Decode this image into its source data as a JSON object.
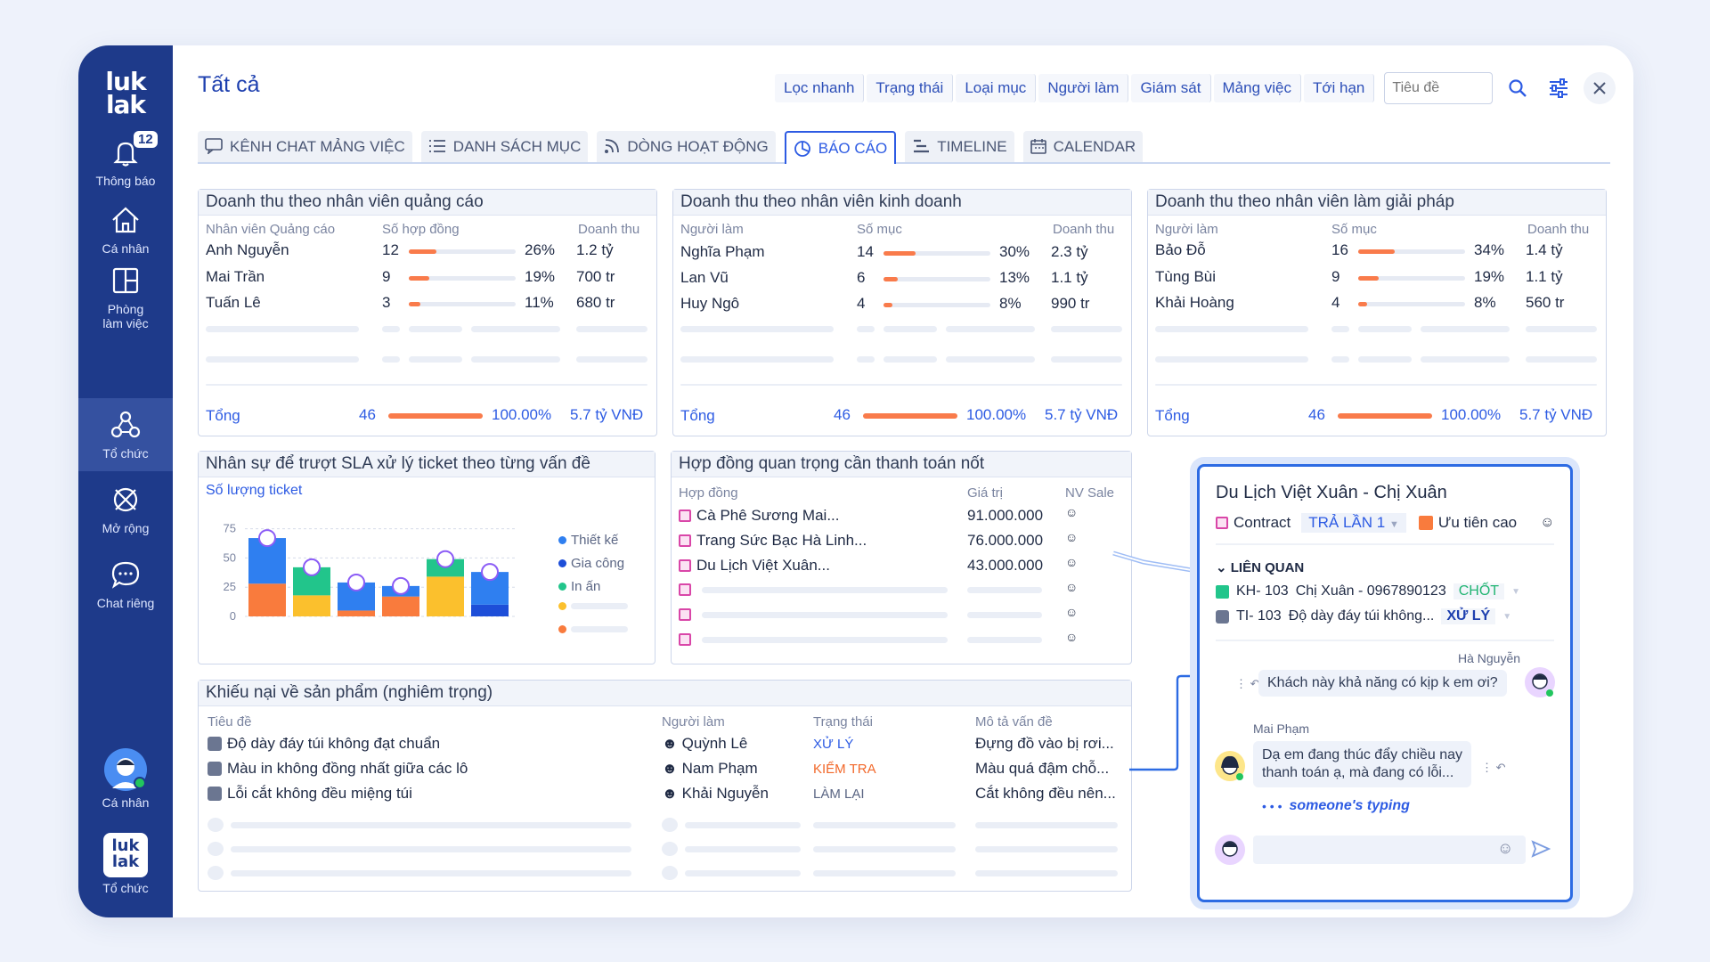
{
  "sidebar": {
    "logo": "luk lak",
    "notif_count": "12",
    "items": [
      {
        "label": "Thông báo"
      },
      {
        "label": "Cá nhân"
      },
      {
        "label": "Phòng làm việc"
      },
      {
        "label": "Tổ chức"
      },
      {
        "label": "Mở rộng"
      },
      {
        "label": "Chat riêng"
      }
    ],
    "profile_label": "Cá nhân",
    "org_label": "Tổ chức",
    "org_logo": "luk lak"
  },
  "header": {
    "title": "Tất cả",
    "filters": [
      "Lọc nhanh",
      "Trạng thái",
      "Loại mục",
      "Người làm",
      "Giám sát",
      "Mảng việc",
      "Tới hạn"
    ],
    "search_placeholder": "Tiêu đề"
  },
  "tabs": [
    "KÊNH CHAT MẢNG VIỆC",
    "DANH SÁCH MỤC",
    "DÒNG HOẠT ĐỘNG",
    "BÁO CÁO",
    "TIMELINE",
    "CALENDAR"
  ],
  "revenue_cards": [
    {
      "title": "Doanh thu theo nhân viên quảng cáo",
      "headers": [
        "Nhân viên Quảng cáo",
        "Số hợp đồng",
        "Doanh thu"
      ],
      "rows": [
        {
          "name": "Anh Nguyễn",
          "count": "12",
          "pct": "26%",
          "pct_value": 26,
          "revenue": "1.2 tỷ"
        },
        {
          "name": "Mai Trần",
          "count": "9",
          "pct": "19%",
          "pct_value": 19,
          "revenue": "700 tr"
        },
        {
          "name": "Tuấn Lê",
          "count": "3",
          "pct": "11%",
          "pct_value": 11,
          "revenue": "680 tr"
        }
      ],
      "total_label": "Tổng",
      "total_count": "46",
      "total_pct": "100.00%",
      "total_revenue": "5.7 tỷ VNĐ"
    },
    {
      "title": "Doanh thu theo nhân viên kinh doanh",
      "headers": [
        "Người làm",
        "Số mục",
        "Doanh thu"
      ],
      "rows": [
        {
          "name": "Nghĩa Phạm",
          "count": "14",
          "pct": "30%",
          "pct_value": 30,
          "revenue": "2.3 tỷ"
        },
        {
          "name": "Lan Vũ",
          "count": "6",
          "pct": "13%",
          "pct_value": 13,
          "revenue": "1.1 tỷ"
        },
        {
          "name": "Huy Ngô",
          "count": "4",
          "pct": "8%",
          "pct_value": 8,
          "revenue": "990 tr"
        }
      ],
      "total_label": "Tổng",
      "total_count": "46",
      "total_pct": "100.00%",
      "total_revenue": "5.7 tỷ VNĐ"
    },
    {
      "title": "Doanh thu theo nhân viên làm giải pháp",
      "headers": [
        "Người làm",
        "Số mục",
        "Doanh thu"
      ],
      "rows": [
        {
          "name": "Bảo Đỗ",
          "count": "16",
          "pct": "34%",
          "pct_value": 34,
          "revenue": "1.4 tỷ"
        },
        {
          "name": "Tùng Bùi",
          "count": "9",
          "pct": "19%",
          "pct_value": 19,
          "revenue": "1.1 tỷ"
        },
        {
          "name": "Khải Hoàng",
          "count": "4",
          "pct": "8%",
          "pct_value": 8,
          "revenue": "560 tr"
        }
      ],
      "total_label": "Tổng",
      "total_count": "46",
      "total_pct": "100.00%",
      "total_revenue": "5.7 tỷ VNĐ"
    }
  ],
  "sla_card": {
    "title": "Nhân sự để trượt SLA xử lý ticket theo từng vấn đề",
    "subtitle": "Số lượng ticket"
  },
  "chart_data": {
    "type": "bar",
    "stacked": true,
    "categories": [
      "",
      "",
      "",
      "",
      "",
      ""
    ],
    "yticks": [
      0,
      25,
      50,
      75
    ],
    "ylim": [
      0,
      80
    ],
    "series": [
      {
        "name": "Thiết kế",
        "color": "#2f7ff0",
        "values": [
          0,
          0,
          24,
          0,
          0,
          28
        ]
      },
      {
        "name": "Gia công",
        "color": "#1d4ed8",
        "values": [
          0,
          0,
          0,
          0,
          0,
          10
        ]
      },
      {
        "name": "In ấn",
        "color": "#22c58b",
        "values": [
          0,
          24,
          0,
          0,
          15,
          0
        ]
      },
      {
        "name": "",
        "color": "#fbc02d",
        "values": [
          0,
          18,
          0,
          0,
          34,
          0
        ]
      },
      {
        "name": "",
        "color": "#f97b3d",
        "values": [
          28,
          0,
          5,
          17,
          0,
          0
        ]
      },
      {
        "name": "",
        "color": "#2f7ff0",
        "values": [
          39,
          0,
          0,
          0,
          0,
          0
        ]
      },
      {
        "name": "",
        "color": "#2f7ff0",
        "values": [
          0,
          0,
          0,
          9,
          0,
          0
        ]
      }
    ],
    "legend_position": "right",
    "grid": true
  },
  "contract_card": {
    "title": "Hợp đồng quan trọng cần thanh toán nốt",
    "headers": [
      "Hợp đồng",
      "Giá trị",
      "NV Sale"
    ],
    "rows": [
      {
        "name": "Cà Phê Sương Mai...",
        "value": "91.000.000"
      },
      {
        "name": "Trang Sức Bạc Hà Linh...",
        "value": "76.000.000"
      },
      {
        "name": "Du Lịch Việt Xuân...",
        "value": "43.000.000"
      }
    ]
  },
  "complaint_card": {
    "title": "Khiếu nại về sản phẩm (nghiêm trọng)",
    "headers": [
      "Tiêu đề",
      "Người làm",
      "Trạng thái",
      "Mô tả vấn đề"
    ],
    "rows": [
      {
        "title": "Độ dày đáy túi không đạt chuẩn",
        "person": "Quỳnh Lê",
        "status": "XỬ LÝ",
        "status_color": "#2d5be3",
        "desc": "Đựng đồ vào bị rơi..."
      },
      {
        "title": "Màu in không đồng nhất giữa các lô",
        "person": "Nam Phạm",
        "status": "KIỂM TRA",
        "status_color": "#f2682a",
        "desc": "Màu quá đậm chỗ..."
      },
      {
        "title": "Lỗi cắt không đều miệng túi",
        "person": "Khải Nguyễn",
        "status": "LÀM LẠI",
        "status_color": "#5b6684",
        "desc": "Cắt không đều nên..."
      }
    ]
  },
  "popup": {
    "title": "Du Lịch Việt Xuân - Chị Xuân",
    "type_label": "Contract",
    "pay_label": "TRẢ LẦN 1",
    "priority_label": "Ưu tiên cao",
    "related_label": "LIÊN QUAN",
    "related": [
      {
        "code": "KH- 103",
        "text": "Chị Xuân - 0967890123",
        "status": "CHỐT",
        "status_color": "#22b573"
      },
      {
        "code": "TI- 103",
        "text": "Độ dày đáy túi không...",
        "status": "XỬ LÝ",
        "status_color": "#1e40af"
      }
    ],
    "msg1_author": "Hà Nguyễn",
    "msg1_text": "Khách này khả năng có kịp k em ơi?",
    "msg2_author": "Mai Phạm",
    "msg2_line1": "Dạ em đang thúc đẩy chiều nay",
    "msg2_line2": "thanh toán ạ, mà đang có lỗi...",
    "typing": "someone's typing"
  }
}
